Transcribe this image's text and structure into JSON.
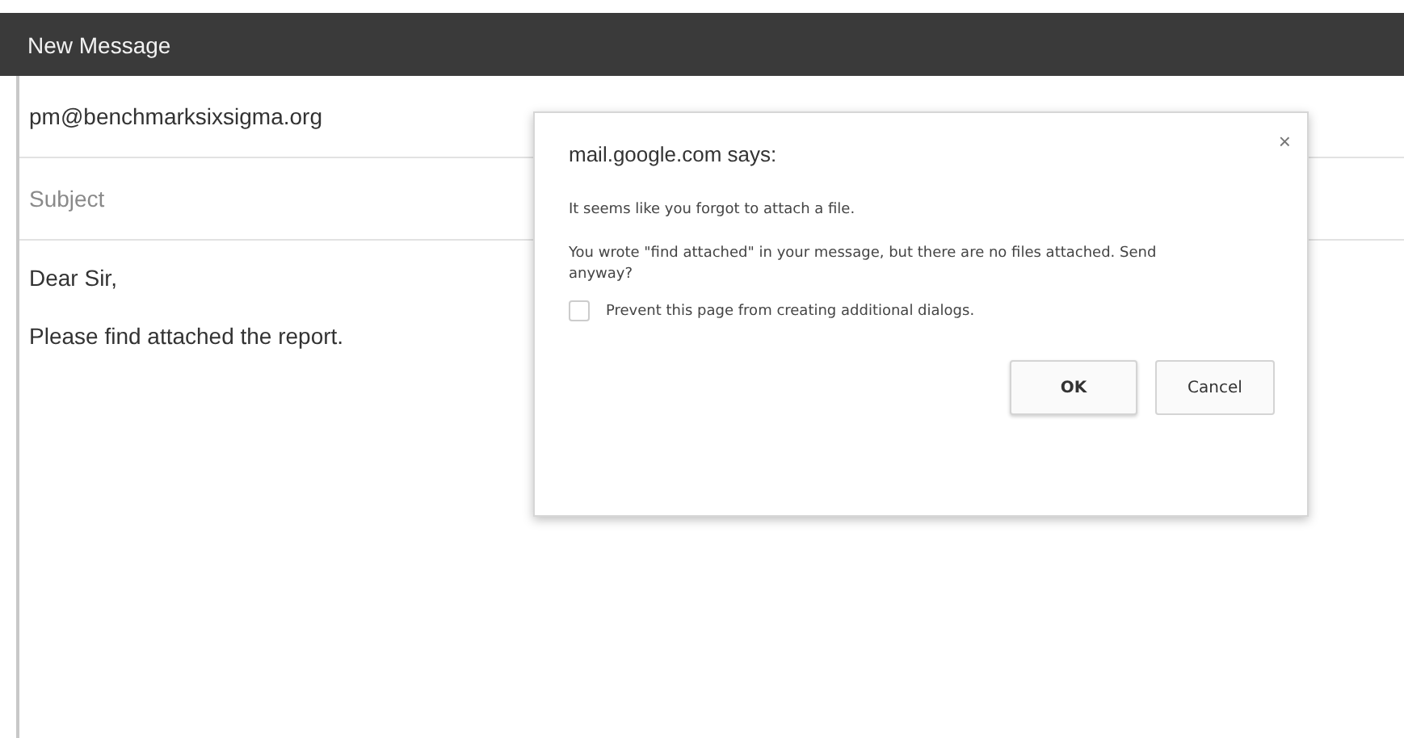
{
  "window": {
    "title": "New Message"
  },
  "compose": {
    "to": "pm@benchmarksixsigma.org",
    "subject_placeholder": "Subject",
    "body": [
      "Dear Sir,",
      "Please find attached the report."
    ]
  },
  "dialog": {
    "title": "mail.google.com says:",
    "close": "×",
    "message": "It seems like you forgot to attach a file.",
    "detail": "You wrote \"find attached\" in your message, but there are no files attached. Send anyway?",
    "prevent": {
      "label": "Prevent this page from creating additional dialogs.",
      "checked": false
    },
    "buttons": [
      {
        "label": "OK",
        "kind": "primary"
      },
      {
        "label": "Cancel",
        "kind": "secondary"
      }
    ]
  }
}
